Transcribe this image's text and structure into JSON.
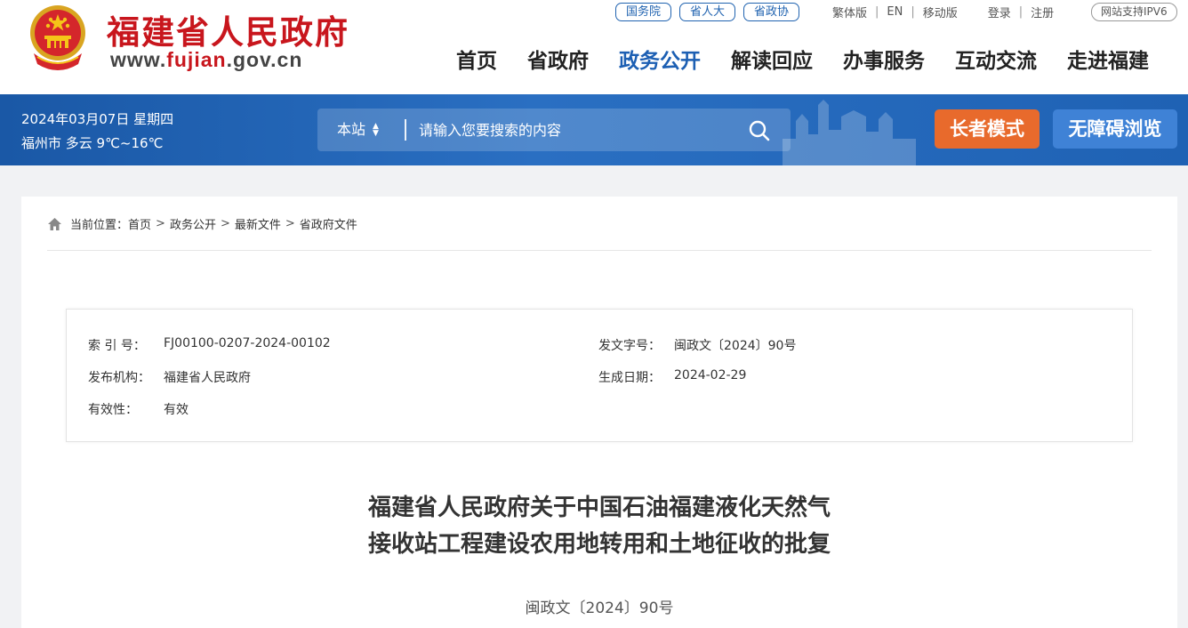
{
  "header": {
    "site_name": "福建省人民政府",
    "url_prefix": "www.",
    "url_mid": "fujian",
    "url_suffix": ".gov.cn",
    "emblem_icon": "national-emblem-icon",
    "top_pills": [
      "国务院",
      "省人大",
      "省政协"
    ],
    "lang_links": [
      "繁体版",
      "EN",
      "移动版"
    ],
    "account_links": [
      "登录",
      "注册"
    ],
    "ipv6_label": "网站支持IPV6",
    "nav": [
      {
        "label": "首页",
        "active": false
      },
      {
        "label": "省政府",
        "active": false
      },
      {
        "label": "政务公开",
        "active": true
      },
      {
        "label": "解读回应",
        "active": false
      },
      {
        "label": "办事服务",
        "active": false
      },
      {
        "label": "互动交流",
        "active": false
      },
      {
        "label": "走进福建",
        "active": false
      }
    ]
  },
  "band": {
    "date": "2024年03月07日 星期四",
    "weather": "福州市 多云 9℃~16℃",
    "search_scope": "本站",
    "search_placeholder": "请输入您要搜索的内容",
    "search_icon": "search-icon",
    "elder_mode_label": "长者模式",
    "accessibility_label": "无障碍浏览"
  },
  "breadcrumb": {
    "prefix": "当前位置：",
    "items": [
      "首页",
      "政务公开",
      "最新文件",
      "省政府文件"
    ],
    "separator": ">",
    "icon": "home-icon"
  },
  "meta": {
    "index_label": "索 引 号：",
    "index_value": "FJ00100-0207-2024-00102",
    "doc_no_label": "发文字号：",
    "doc_no_value": "闽政文〔2024〕90号",
    "issuer_label": "发布机构：",
    "issuer_value": "福建省人民政府",
    "date_label": "生成日期：",
    "date_value": "2024-02-29",
    "validity_label": "有效性：",
    "validity_value": "有效"
  },
  "document": {
    "title_line1": "福建省人民政府关于中国石油福建液化天然气",
    "title_line2": "接收站工程建设农用地转用和土地征收的批复",
    "number": "闽政文〔2024〕90号"
  },
  "colors": {
    "brand_red": "#c8161d",
    "nav_active": "#1c5fb3",
    "band_blue": "#1f62b4",
    "elder_orange": "#e86a2c",
    "access_blue": "#3f82d6"
  }
}
